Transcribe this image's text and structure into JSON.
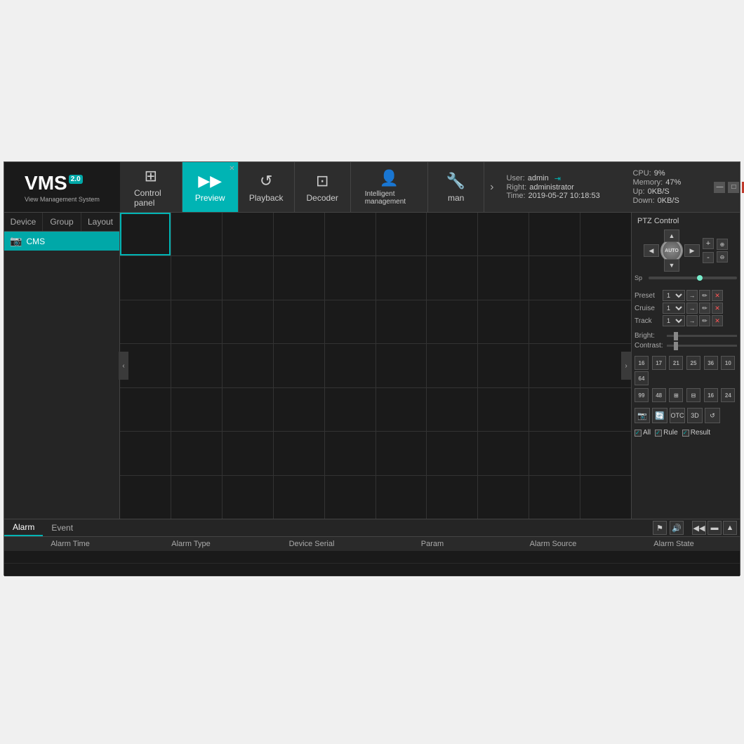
{
  "app": {
    "title": "VMS - View Management System",
    "version": "2.0",
    "subtitle": "View Management System"
  },
  "nav": {
    "tabs": [
      {
        "id": "control-panel",
        "label": "Control panel",
        "icon": "⊞",
        "active": false
      },
      {
        "id": "preview",
        "label": "Preview",
        "icon": "▶",
        "active": true,
        "closeable": true
      },
      {
        "id": "playback",
        "label": "Playback",
        "icon": "↺",
        "active": false
      },
      {
        "id": "decoder",
        "label": "Decoder",
        "icon": "⊡",
        "active": false
      },
      {
        "id": "intelligent",
        "label": "Intelligent management",
        "icon": "👤",
        "active": false
      },
      {
        "id": "man",
        "label": "man",
        "icon": "🔧",
        "active": false
      }
    ]
  },
  "system_info": {
    "user_label": "User:",
    "user_value": "admin",
    "right_label": "Right:",
    "right_value": "administrator",
    "time_label": "Time:",
    "time_value": "2019-05-27 10:18:53",
    "cpu_label": "CPU:",
    "cpu_value": "9%",
    "memory_label": "Memory:",
    "memory_value": "47%",
    "up_label": "Up:",
    "up_value": "0KB/S",
    "down_label": "Down:",
    "down_value": "0KB/S"
  },
  "sidebar": {
    "tabs": [
      {
        "id": "device",
        "label": "Device"
      },
      {
        "id": "group",
        "label": "Group"
      },
      {
        "id": "layout",
        "label": "Layout"
      }
    ],
    "items": [
      {
        "id": "cms",
        "label": "CMS",
        "icon": "📷",
        "active": true
      }
    ]
  },
  "ptz": {
    "title": "PTZ Control",
    "speed_label": "Sp",
    "auto_label": "AUTO",
    "preset_label": "Preset",
    "preset_value": "1",
    "cruise_label": "Cruise",
    "cruise_value": "1",
    "track_label": "Track",
    "track_value": "1",
    "bright_label": "Bright:",
    "contrast_label": "Contrast:",
    "checkboxes": [
      {
        "id": "all",
        "label": "All",
        "checked": true
      },
      {
        "id": "rule",
        "label": "Rule",
        "checked": true
      },
      {
        "id": "result",
        "label": "Result",
        "checked": true
      }
    ]
  },
  "bottom": {
    "tabs": [
      {
        "id": "alarm",
        "label": "Alarm",
        "active": true
      },
      {
        "id": "event",
        "label": "Event",
        "active": false
      }
    ],
    "table": {
      "columns": [
        "Alarm Time",
        "Alarm Type",
        "Device Serial",
        "Param",
        "Alarm Source",
        "Alarm State"
      ]
    }
  },
  "icons": {
    "up_arrow": "▲",
    "down_arrow": "▼",
    "left_arrow": "◀",
    "right_arrow": "▶",
    "zoom_plus": "+",
    "zoom_minus": "-",
    "go": "→",
    "edit": "✏",
    "delete": "✕",
    "camera": "📷",
    "settings": "⚙",
    "record": "⬤",
    "screen": "⬛",
    "expand": "⤢",
    "chevron_left": "‹",
    "chevron_right": "›"
  }
}
